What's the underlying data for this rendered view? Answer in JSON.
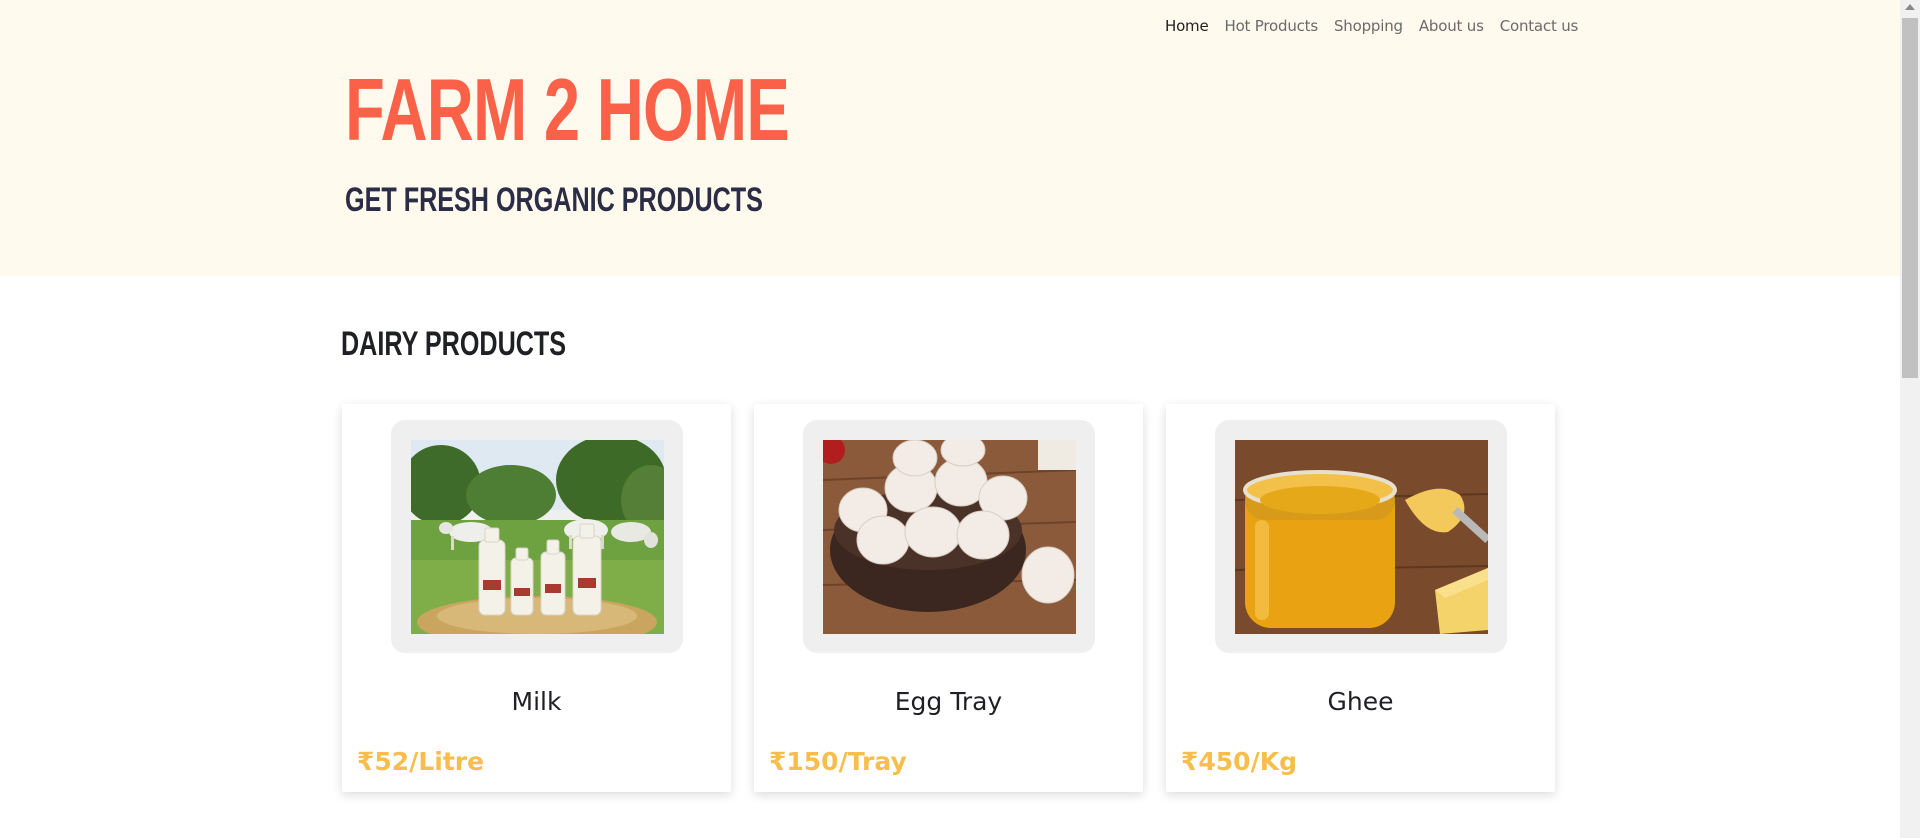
{
  "nav": {
    "items": [
      {
        "label": "Home",
        "active": true
      },
      {
        "label": "Hot Products",
        "active": false
      },
      {
        "label": "Shopping",
        "active": false
      },
      {
        "label": "About us",
        "active": false
      },
      {
        "label": "Contact us",
        "active": false
      }
    ]
  },
  "hero": {
    "title": "FARM 2 HOME",
    "subtitle": "GET FRESH ORGANIC PRODUCTS"
  },
  "section": {
    "title": "DAIRY PRODUCTS"
  },
  "products": [
    {
      "name": "Milk",
      "price": "₹52/Litre",
      "image_icon": "milk-bottles-image"
    },
    {
      "name": "Egg Tray",
      "price": "₹150/Tray",
      "image_icon": "eggs-bowl-image"
    },
    {
      "name": "Ghee",
      "price": "₹450/Kg",
      "image_icon": "ghee-jar-image"
    }
  ],
  "colors": {
    "hero_bg": "#fff9ee",
    "brand": "#fa6149",
    "subtitle": "#2b2d47",
    "price": "#f7be4c"
  }
}
